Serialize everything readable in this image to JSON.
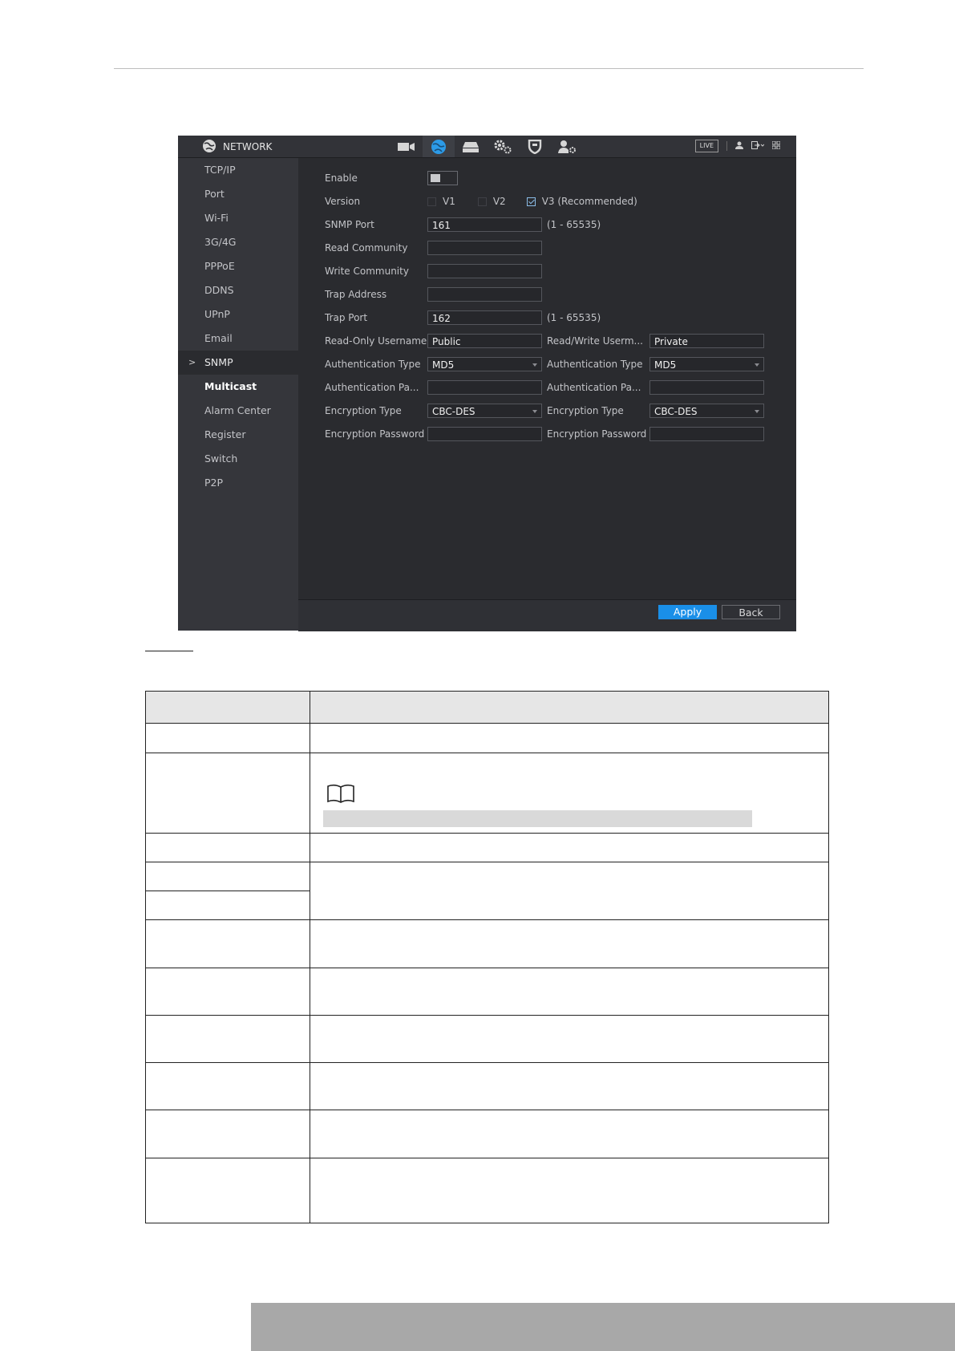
{
  "app": {
    "title": "NETWORK",
    "top_icons": [
      "camera-icon",
      "network-globe-icon",
      "storage-icon",
      "settings-gears-icon",
      "shield-icon",
      "account-gear-icon"
    ],
    "live_label": "LIVE",
    "colors": {
      "accent": "#1a8fe8",
      "background": "#2a2b2f",
      "sidebar": "#35363b"
    }
  },
  "sidebar": {
    "items": [
      {
        "label": "TCP/IP"
      },
      {
        "label": "Port"
      },
      {
        "label": "Wi-Fi"
      },
      {
        "label": "3G/4G"
      },
      {
        "label": "PPPoE"
      },
      {
        "label": "DDNS"
      },
      {
        "label": "UPnP"
      },
      {
        "label": "Email"
      },
      {
        "label": "SNMP",
        "selected": true
      },
      {
        "label": "Multicast"
      },
      {
        "label": "Alarm Center"
      },
      {
        "label": "Register"
      },
      {
        "label": "Switch"
      },
      {
        "label": "P2P"
      }
    ]
  },
  "form": {
    "enable_label": "Enable",
    "version_label": "Version",
    "v1_label": "V1",
    "v2_label": "V2",
    "v3_label": "V3 (Recommended)",
    "snmp_port_label": "SNMP Port",
    "snmp_port_value": "161",
    "snmp_port_hint": "(1 - 65535)",
    "read_community_label": "Read Community",
    "read_community_value": "",
    "write_community_label": "Write Community",
    "write_community_value": "",
    "trap_address_label": "Trap Address",
    "trap_address_value": "",
    "trap_port_label": "Trap Port",
    "trap_port_value": "162",
    "trap_port_hint": "(1 - 65535)",
    "ro_username_label": "Read-Only Username",
    "ro_username_value": "Public",
    "rw_username_label": "Read/Write Userm...",
    "rw_username_value": "Private",
    "auth_type_label": "Authentication Type",
    "auth_type_ro_value": "MD5",
    "auth_type_rw_value": "MD5",
    "auth_pass_label": "Authentication Pa...",
    "enc_type_label": "Encryption Type",
    "enc_type_ro_value": "CBC-DES",
    "enc_type_rw_value": "CBC-DES",
    "enc_pass_label": "Encryption Password"
  },
  "footer": {
    "apply_label": "Apply",
    "back_label": "Back"
  }
}
